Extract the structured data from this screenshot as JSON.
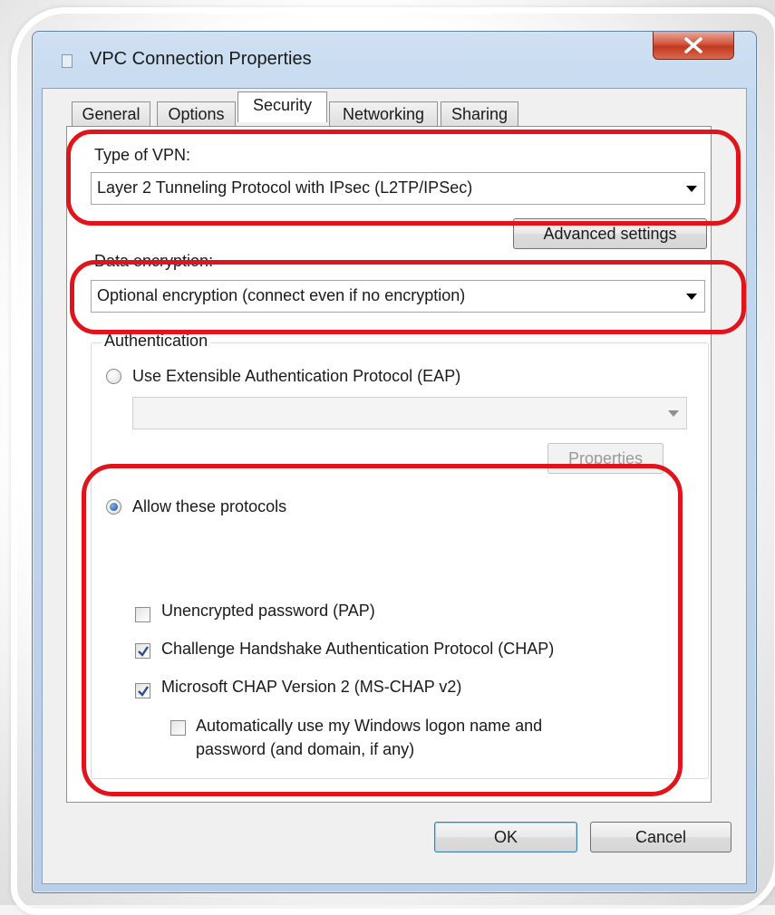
{
  "window": {
    "title": "VPC Connection Properties",
    "close_glyph": "X"
  },
  "tabs": [
    {
      "label": "General",
      "active": false
    },
    {
      "label": "Options",
      "active": false
    },
    {
      "label": "Security",
      "active": true
    },
    {
      "label": "Networking",
      "active": false
    },
    {
      "label": "Sharing",
      "active": false
    }
  ],
  "security": {
    "vpn_type_label": "Type of VPN:",
    "vpn_type_value": "Layer 2 Tunneling Protocol with IPsec (L2TP/IPSec)",
    "advanced_settings_label": "Advanced settings",
    "data_encryption_label": "Data encryption:",
    "data_encryption_value": "Optional encryption (connect even if no encryption)",
    "authentication": {
      "group_label": "Authentication",
      "eap_label": "Use Extensible Authentication Protocol (EAP)",
      "eap_selected": false,
      "eap_combo_value": "",
      "properties_label": "Properties",
      "allow_label": "Allow these protocols",
      "allow_selected": true,
      "protocols": [
        {
          "label": "Unencrypted password (PAP)",
          "checked": false
        },
        {
          "label": "Challenge Handshake Authentication Protocol (CHAP)",
          "checked": true
        },
        {
          "label": "Microsoft CHAP Version 2 (MS-CHAP v2)",
          "checked": true
        }
      ],
      "auto_logon_line1": "Automatically use my Windows logon name and",
      "auto_logon_line2": "password (and domain, if any)",
      "auto_logon_checked": false
    }
  },
  "buttons": {
    "ok": "OK",
    "cancel": "Cancel"
  },
  "annotation_color": "#e0151c"
}
